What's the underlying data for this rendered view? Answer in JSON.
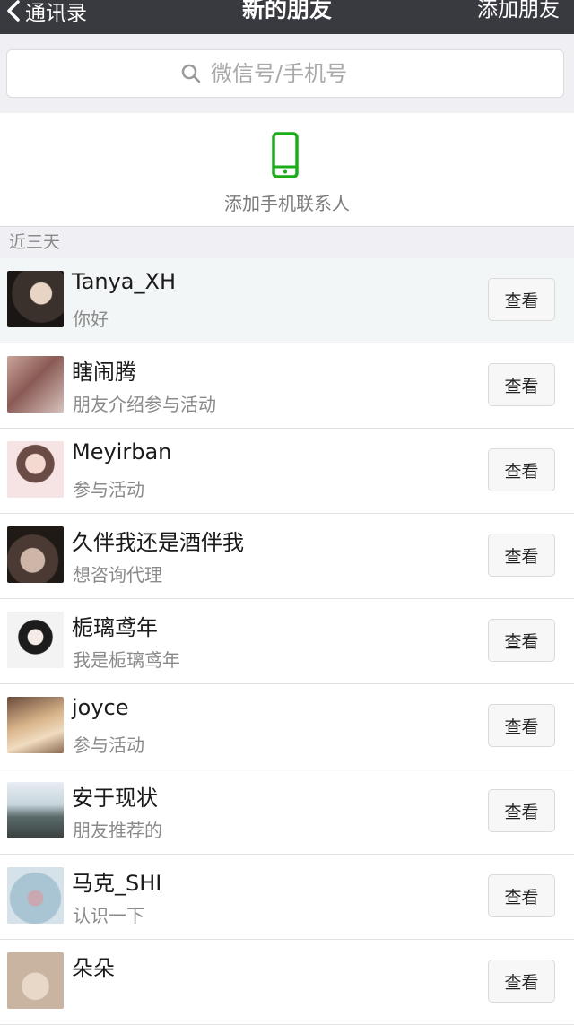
{
  "nav": {
    "back_label": "通讯录",
    "title": "新的朋友",
    "add_label": "添加朋友"
  },
  "search": {
    "placeholder": "微信号/手机号"
  },
  "add_phone_contacts": {
    "label": "添加手机联系人",
    "icon": "phone-icon",
    "color": "#1aad19"
  },
  "section_header": "近三天",
  "contacts": [
    {
      "name": "Tanya_XH",
      "message": "你好",
      "button": "查看"
    },
    {
      "name": "瞎闹腾",
      "message": "朋友介绍参与活动",
      "button": "查看"
    },
    {
      "name": "Meyirban",
      "message": "参与活动",
      "button": "查看"
    },
    {
      "name": "久伴我还是酒伴我",
      "message": "想咨询代理",
      "button": "查看"
    },
    {
      "name": "栀璃鸢年",
      "message": "我是栀璃鸢年",
      "button": "查看"
    },
    {
      "name": "joyce",
      "message": "参与活动",
      "button": "查看"
    },
    {
      "name": "安于现状",
      "message": "朋友推荐的",
      "button": "查看"
    },
    {
      "name": "马克_SHI",
      "message": "认识一下",
      "button": "查看"
    },
    {
      "name": "朵朵",
      "message": "",
      "button": "查看"
    }
  ]
}
